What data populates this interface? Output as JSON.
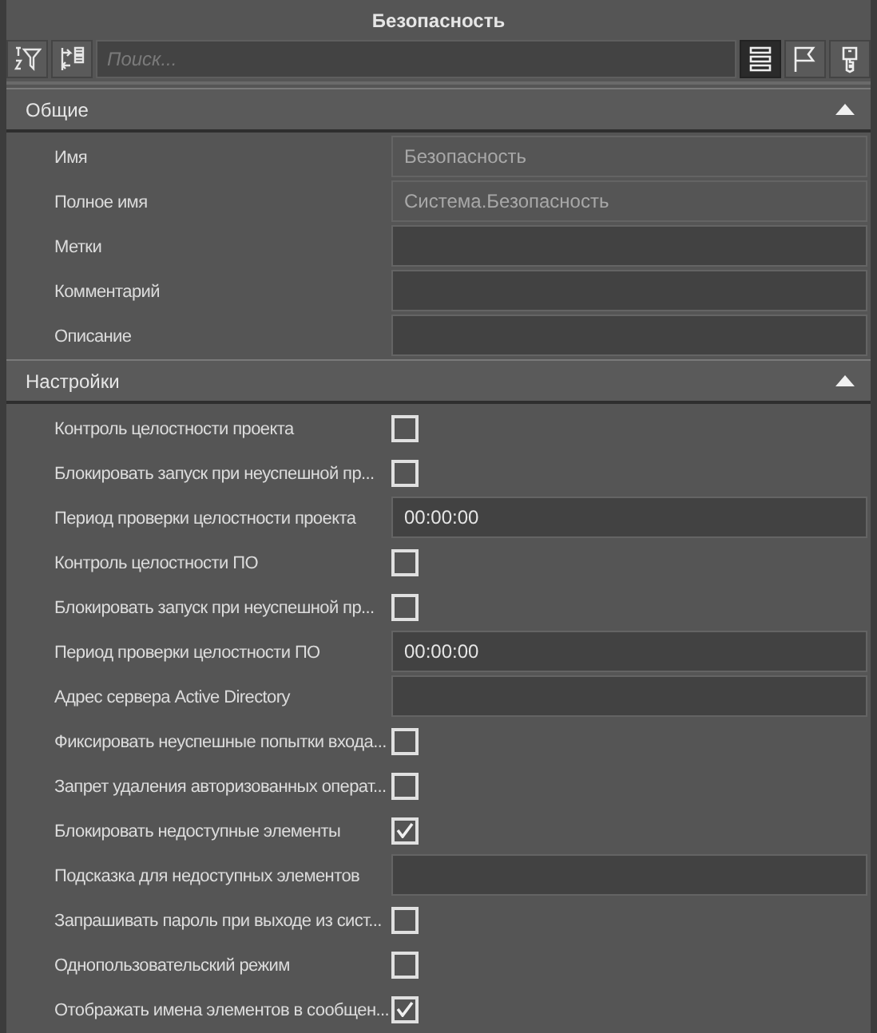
{
  "window": {
    "title": "Безопасность"
  },
  "toolbar": {
    "search": {
      "placeholder": "Поиск..."
    },
    "view_buttons": [
      {
        "kind": "list",
        "selected": true
      },
      {
        "kind": "flag",
        "selected": false
      },
      {
        "kind": "key",
        "selected": false
      }
    ]
  },
  "sections": [
    {
      "title": "Общие",
      "expanded": true,
      "rows": [
        {
          "label": "Имя",
          "kind": "field",
          "value": "Безопасность",
          "readonly": true
        },
        {
          "label": "Полное имя",
          "kind": "field",
          "value": "Система.Безопасность",
          "readonly": true
        },
        {
          "label": "Метки",
          "kind": "field",
          "readonly": false
        },
        {
          "label": "Комментарий",
          "kind": "field",
          "readonly": false
        },
        {
          "label": "Описание",
          "kind": "field",
          "readonly": false
        }
      ]
    },
    {
      "title": "Настройки",
      "expanded": true,
      "rows": [
        {
          "label": "Контроль целостности проекта",
          "kind": "checkbox",
          "checked": false
        },
        {
          "label": "Блокировать запуск при неуспешной пр...",
          "kind": "checkbox",
          "checked": false
        },
        {
          "label": "Период проверки целостности проекта",
          "kind": "field",
          "value": "00:00:00",
          "readonly": false
        },
        {
          "label": "Контроль целостности ПО",
          "kind": "checkbox",
          "checked": false
        },
        {
          "label": "Блокировать запуск при неуспешной пр...",
          "kind": "checkbox",
          "checked": false
        },
        {
          "label": "Период проверки целостности ПО",
          "kind": "field",
          "value": "00:00:00",
          "readonly": false
        },
        {
          "label": "Адрес сервера Active Directory",
          "kind": "field",
          "readonly": false
        },
        {
          "label": "Фиксировать неуспешные попытки входа...",
          "kind": "checkbox",
          "checked": false
        },
        {
          "label": "Запрет удаления авторизованных операт...",
          "kind": "checkbox",
          "checked": false
        },
        {
          "label": "Блокировать недоступные элементы",
          "kind": "checkbox",
          "checked": true
        },
        {
          "label": "Подсказка для недоступных элементов",
          "kind": "field",
          "readonly": false
        },
        {
          "label": "Запрашивать пароль при выходе из сист...",
          "kind": "checkbox",
          "checked": false
        },
        {
          "label": "Однопользовательский режим",
          "kind": "checkbox",
          "checked": false
        },
        {
          "label": "Отображать имена элементов в сообщен...",
          "kind": "checkbox",
          "checked": true
        }
      ]
    }
  ]
}
